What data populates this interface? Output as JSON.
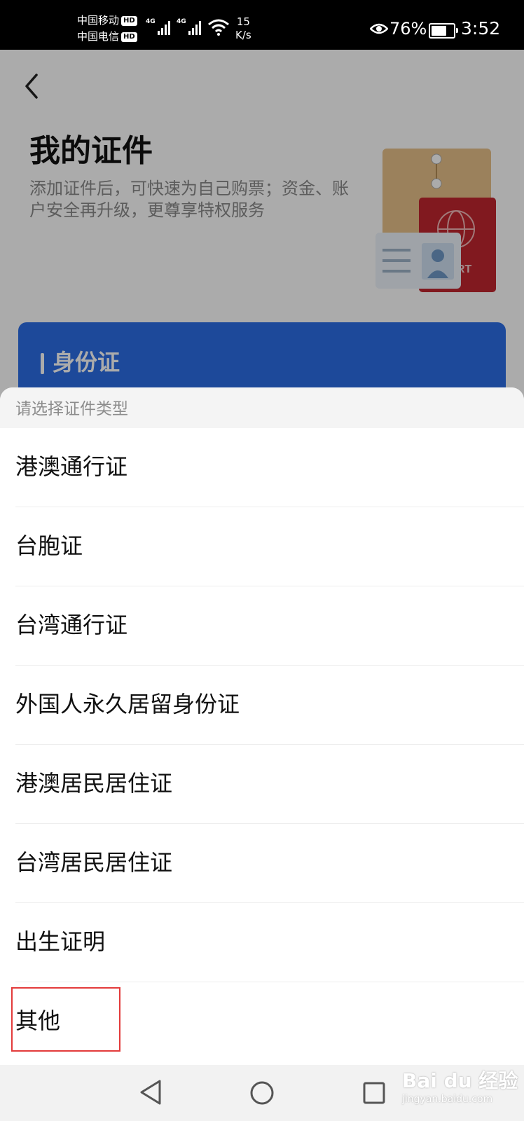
{
  "status_bar": {
    "carrier1": "中国移动",
    "carrier2": "中国电信",
    "hd_badge": "HD",
    "network1": "4G",
    "network2": "4G",
    "speed_value": "15",
    "speed_unit": "K/s",
    "battery_percent": "76%",
    "battery_level": 0.76,
    "time": "3:52",
    "icons": [
      "signal-icon",
      "wifi-icon",
      "eye-icon",
      "battery-icon"
    ]
  },
  "page": {
    "title": "我的证件",
    "subtitle": "添加证件后，可快速为自己购票；资金、账户安全再升级，更尊享特权服务",
    "id_card_title": "身份证",
    "hero_passport_text": "PORT",
    "accent_color": "#2c6ee6"
  },
  "sheet": {
    "header": "请选择证件类型",
    "options": [
      "港澳通行证",
      "台胞证",
      "台湾通行证",
      "外国人永久居留身份证",
      "港澳居民居住证",
      "台湾居民居住证",
      "出生证明",
      "其他"
    ],
    "highlight_color": "#e33b3b"
  },
  "nav_bar": {
    "icons": [
      "back-triangle-icon",
      "home-circle-icon",
      "recent-square-icon"
    ]
  },
  "watermark": {
    "line1": "Bai du 经验",
    "line2": "jingyan.baidu.com"
  }
}
